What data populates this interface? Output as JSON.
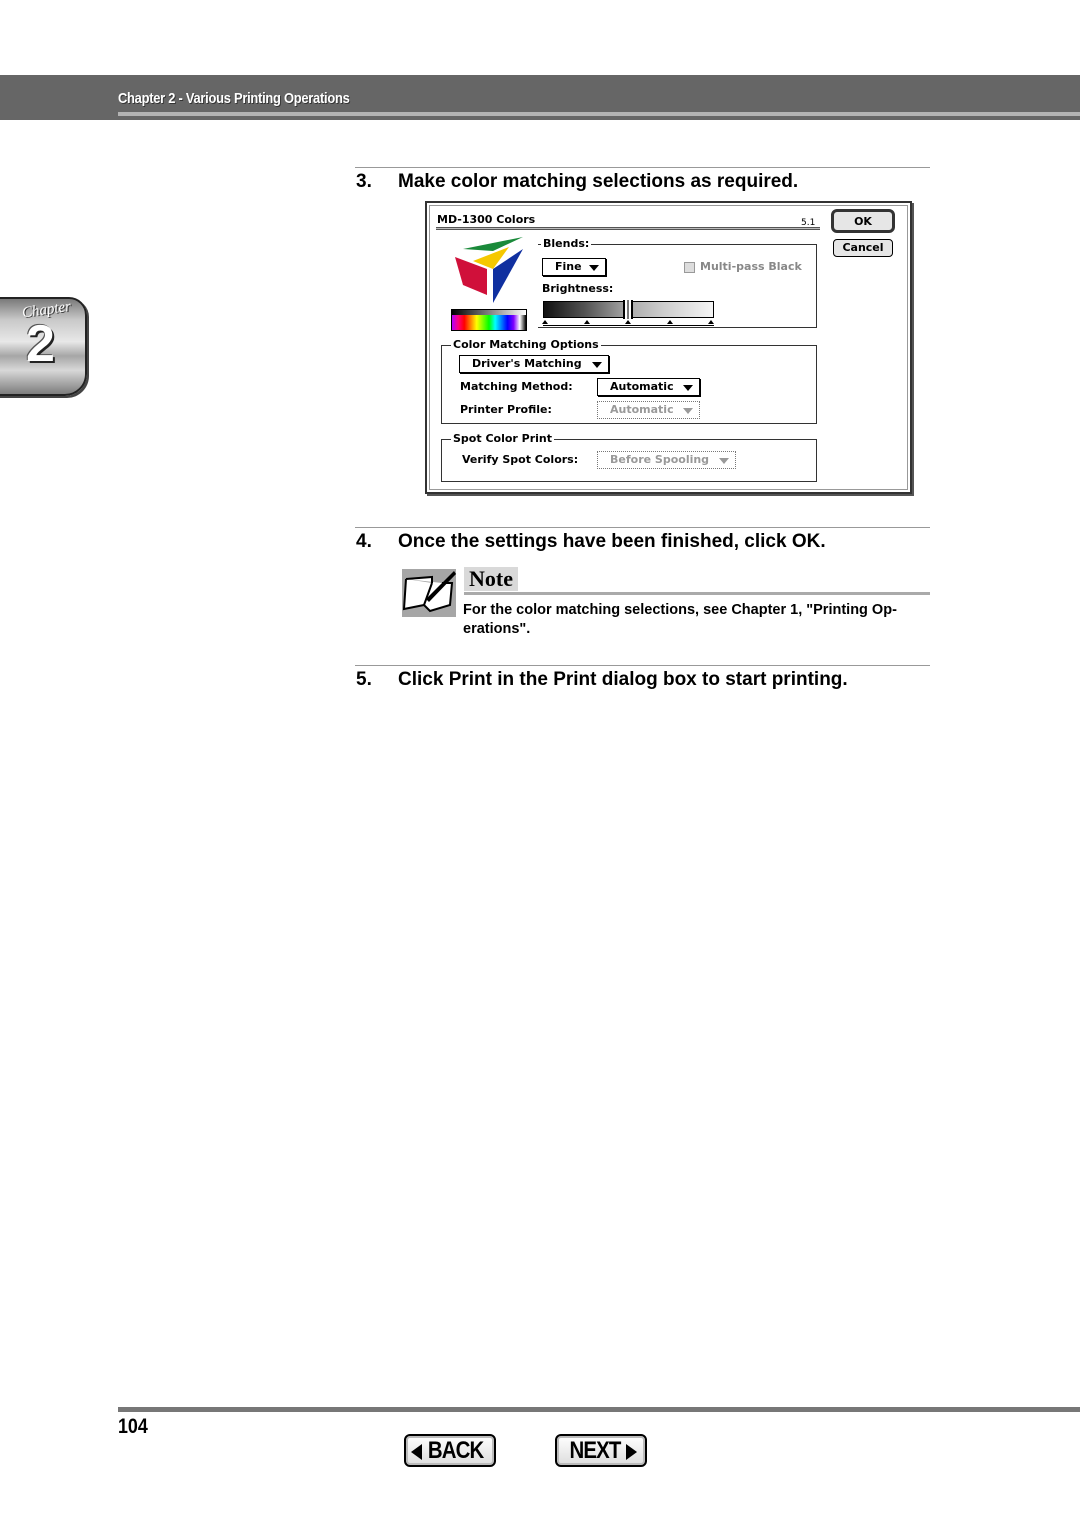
{
  "header": {
    "title": "Chapter 2 - Various Printing Operations"
  },
  "chapter_tab": {
    "word": "Chapter",
    "number": "2"
  },
  "steps": [
    {
      "number": "3.",
      "text": "Make color matching selections as required."
    },
    {
      "number": "4.",
      "text": "Once the settings have been finished, click OK."
    },
    {
      "number": "5.",
      "text": "Click Print in the Print dialog box to start printing."
    }
  ],
  "dialog": {
    "title": "MD-1300 Colors",
    "version": "5.1",
    "ok_label": "OK",
    "cancel_label": "Cancel",
    "blends": {
      "label": "Blends:",
      "selected": "Fine",
      "multipass_label": "Multi-pass Black",
      "multipass_checked": false,
      "multipass_enabled": false
    },
    "brightness": {
      "label": "Brightness:",
      "value_fraction": 0.5,
      "tick_count": 5
    },
    "color_matching": {
      "group_label": "Color Matching Options",
      "mode_selected": "Driver's Matching",
      "method_label": "Matching Method:",
      "method_selected": "Automatic",
      "profile_label": "Printer Profile:",
      "profile_selected": "Automatic",
      "profile_enabled": false
    },
    "spot_color": {
      "group_label": "Spot Color Print",
      "verify_label": "Verify Spot Colors:",
      "verify_selected": "Before Spooling",
      "verify_enabled": false
    }
  },
  "note": {
    "title": "Note",
    "text": "For the color matching selections, see Chapter 1, \"Printing Op- erations\"."
  },
  "footer": {
    "page_number": "104",
    "back_label": "BACK",
    "next_label": "NEXT"
  }
}
